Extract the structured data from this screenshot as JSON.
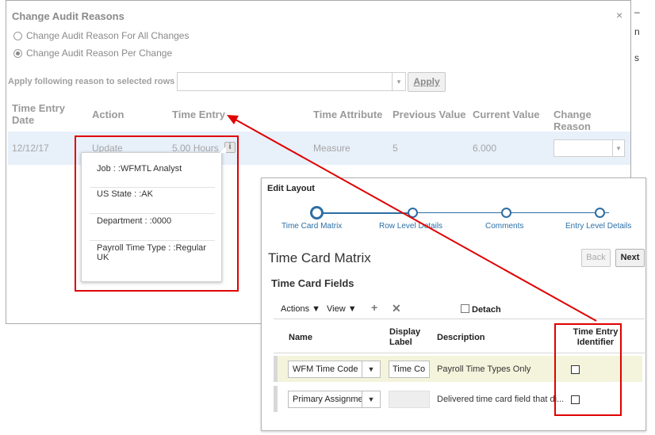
{
  "audit_dialog": {
    "title": "Change Audit Reasons",
    "close": "×",
    "radio_all": "Change Audit Reason For All Changes",
    "radio_per": "Change Audit Reason Per Change",
    "apply_label": "Apply following reason to selected rows",
    "apply_button": "Apply",
    "columns": [
      "Time Entry Date",
      "Action",
      "Time Entry",
      "Time Attribute",
      "Previous Value",
      "Current Value",
      "Change Reason"
    ],
    "row": {
      "date": "12/12/17",
      "action": "Update",
      "time_entry": "5.00 Hours",
      "attribute": "Measure",
      "previous": "5",
      "current": "6.000"
    },
    "popup_items": [
      "Job : :WFMTL Analyst",
      "US State : :AK",
      "Department : :0000",
      "Payroll Time Type : :Regular UK"
    ]
  },
  "edit_dialog": {
    "title": "Edit Layout",
    "train": [
      "Time Card Matrix",
      "Row Level Details",
      "Comments",
      "Entry Level Details"
    ],
    "page_title": "Time Card Matrix",
    "back": "Back",
    "next": "Next",
    "section": "Time Card Fields",
    "toolbar": {
      "actions": "Actions",
      "view": "View",
      "detach": "Detach"
    },
    "columns": {
      "name": "Name",
      "display_label": "Display Label",
      "description": "Description",
      "identifier": "Time Entry Identifier"
    },
    "rows": [
      {
        "name": "WFM Time Code",
        "label": "Time Co",
        "description": "Payroll Time Types Only",
        "checked": false
      },
      {
        "name": "Primary Assignmer",
        "label": "",
        "description": "Delivered time card field that di...",
        "checked": false
      }
    ]
  },
  "edge_text": [
    "–",
    "n",
    "s"
  ],
  "colors": {
    "highlight_red": "#e00000",
    "train_blue": "#2d6da3",
    "row_select": "#e8f0fa",
    "row_hover": "#f4f4dc"
  }
}
